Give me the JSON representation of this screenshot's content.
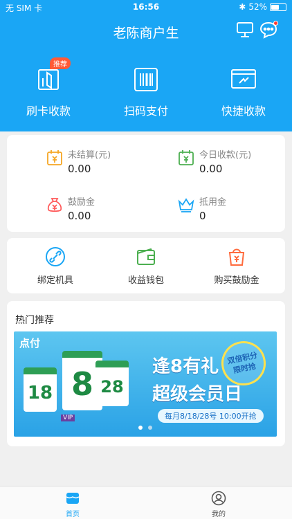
{
  "status_bar": {
    "carrier": "无 SIM 卡",
    "time": "16:56",
    "battery": "52%",
    "battery_level": 0.52
  },
  "header": {
    "title": "老陈商户生"
  },
  "quick_actions": [
    {
      "label": "刷卡收款",
      "icon": "card-swipe-icon",
      "tag": "推荐"
    },
    {
      "label": "扫码支付",
      "icon": "barcode-scan-icon"
    },
    {
      "label": "快捷收款",
      "icon": "quick-pay-icon"
    }
  ],
  "stats": [
    {
      "label": "未结算(元)",
      "value": "0.00",
      "icon": "calendar-yuan-icon",
      "color": "#f5a623"
    },
    {
      "label": "今日收款(元)",
      "value": "0.00",
      "icon": "calendar-check-icon",
      "color": "#4caf50"
    },
    {
      "label": "鼓励金",
      "value": "0.00",
      "icon": "money-bag-icon",
      "color": "#ff5a5a"
    },
    {
      "label": "抵用金",
      "value": "0",
      "icon": "crown-icon",
      "color": "#1aa6f5"
    }
  ],
  "actions": [
    {
      "label": "绑定机具",
      "icon": "link-icon",
      "color": "#1aa6f5"
    },
    {
      "label": "收益钱包",
      "icon": "wallet-icon",
      "color": "#4caf50"
    },
    {
      "label": "购买鼓励金",
      "icon": "shopping-bag-icon",
      "color": "#ff6b3d"
    }
  ],
  "hot": {
    "heading": "热门推荐",
    "banner": {
      "logo": "点付",
      "days": [
        "18",
        "8",
        "28"
      ],
      "headline": "逢8有礼",
      "subline": "超级会员日",
      "badge_line1": "双倍积分",
      "badge_line2": "限时抢",
      "schedule": "每月8/18/28号 10:00开抢",
      "vip": "VIP"
    }
  },
  "tabs": [
    {
      "label": "首页",
      "icon": "home-icon",
      "active": true
    },
    {
      "label": "我的",
      "icon": "user-icon",
      "active": false
    }
  ],
  "colors": {
    "primary": "#1aa6f5",
    "background": "#f0f0f0"
  }
}
